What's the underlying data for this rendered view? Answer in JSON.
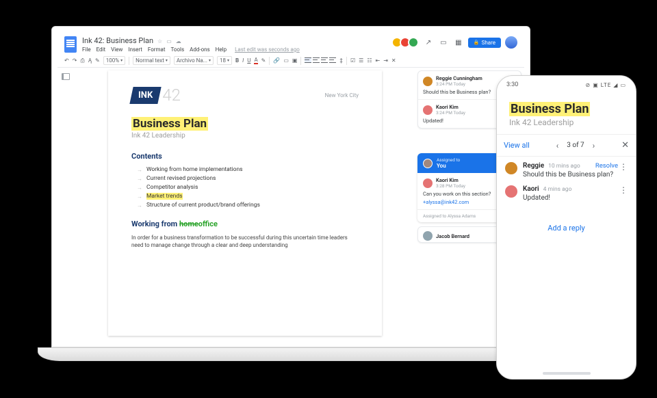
{
  "doc": {
    "title": "Ink 42: Business Plan",
    "menus": [
      "File",
      "Edit",
      "View",
      "Insert",
      "Format",
      "Tools",
      "Add-ons",
      "Help"
    ],
    "last_edit": "Last edit was seconds ago",
    "share": "Share",
    "zoom": "100%",
    "style": "Normal text",
    "font": "Archivo Na...",
    "font_size": "18"
  },
  "page": {
    "brand_ink": "INK",
    "brand_42": "42",
    "city": "New York City",
    "title": "Business Plan",
    "subtitle": "Ink 42 Leadership",
    "contents_h": "Contents",
    "toc": [
      "Working from home implementations",
      "Current revised projections",
      "Competitor analysis",
      "Market trends",
      "Structure of current product/brand offerings"
    ],
    "section_h_w1": "Working from ",
    "section_h_strike": "home",
    "section_h_w3": "office",
    "body": "In order for a business transformation to be successful during this uncertain time leaders need to manage change through a clear and deep understanding"
  },
  "comments": {
    "c1": {
      "name": "Reggie Cunningham",
      "meta": "3:24 PM Today",
      "text": "Should this be Business plan?"
    },
    "c2": {
      "name": "Kaori Kim",
      "meta": "3:24 PM Today",
      "text": "Updated!"
    },
    "assign": {
      "label": "Assigned to",
      "you": "You",
      "name": "Kaori Kim",
      "meta": "3:28 PM Today",
      "text": "Can you work on this section?",
      "mention": "+alyssa@ink42.com",
      "footer": "Assigned to Alyssa Adams"
    },
    "c4": {
      "name": "Jacob Bernard"
    }
  },
  "phone": {
    "time": "3:30",
    "status_icons": "⊘ ▣ LTE ◢ ▭",
    "view_all": "View all",
    "pager": "3 of 7",
    "c1": {
      "name": "Reggie",
      "meta": "10 mins ago",
      "text": "Should this be Business plan?",
      "resolve": "Resolve"
    },
    "c2": {
      "name": "Kaori",
      "meta": "4 mins ago",
      "text": "Updated!"
    },
    "add_reply": "Add a reply"
  },
  "avatar_colors": {
    "a1": "#f4b400",
    "a2": "#ea4335",
    "a3": "#34a853",
    "reggie": "#d08726",
    "kaori": "#e57373",
    "you": "#a1887f",
    "jb": "#90a4ae"
  }
}
